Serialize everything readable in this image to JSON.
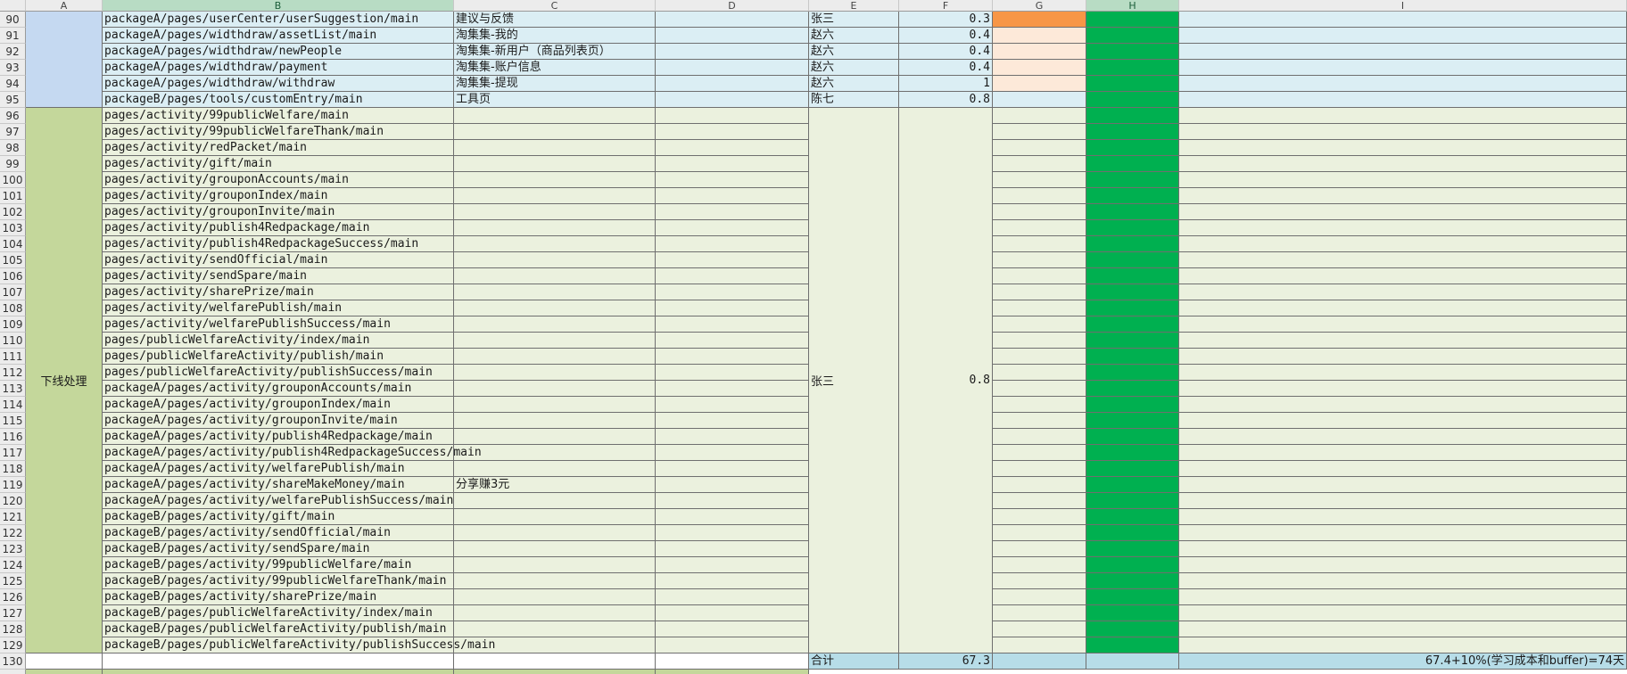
{
  "columns": [
    "A",
    "B",
    "C",
    "D",
    "E",
    "F",
    "G",
    "H",
    "I"
  ],
  "selected_columns": [
    "B",
    "H"
  ],
  "colors": {
    "light_blue": "#dbeef4",
    "mid_blue": "#c5d9f1",
    "total_blue": "#b7dde8",
    "light_green": "#ebf1de",
    "olive_green": "#c4d79b",
    "bright_green": "#00b050",
    "orange": "#f79646",
    "peach": "#fde9d9"
  },
  "rows": [
    {
      "num": "90",
      "b": "packageA/pages/userCenter/userSuggestion/main",
      "c": "建议与反馈",
      "e": "张三",
      "f": "0.3",
      "g": "orange"
    },
    {
      "num": "91",
      "b": "packageA/pages/widthdraw/assetList/main",
      "c": "淘集集-我的",
      "e": "赵六",
      "f": "0.4",
      "g": "peach"
    },
    {
      "num": "92",
      "b": "packageA/pages/widthdraw/newPeople",
      "c": "淘集集-新用户（商品列表页）",
      "e": "赵六",
      "f": "0.4",
      "g": "peach"
    },
    {
      "num": "93",
      "b": "packageA/pages/widthdraw/payment",
      "c": "淘集集-账户信息",
      "e": "赵六",
      "f": "0.4",
      "g": "peach"
    },
    {
      "num": "94",
      "b": "packageA/pages/widthdraw/withdraw",
      "c": "淘集集-提现",
      "e": "赵六",
      "f": "1",
      "g": "peach"
    },
    {
      "num": "95",
      "b": "packageB/pages/tools/customEntry/main",
      "c": "工具页",
      "e": "陈七",
      "f": "0.8",
      "g": "light_blue"
    },
    {
      "num": "96",
      "b": "pages/activity/99publicWelfare/main",
      "c": ""
    },
    {
      "num": "97",
      "b": "pages/activity/99publicWelfareThank/main",
      "c": ""
    },
    {
      "num": "98",
      "b": "pages/activity/redPacket/main",
      "c": ""
    },
    {
      "num": "99",
      "b": "pages/activity/gift/main",
      "c": ""
    },
    {
      "num": "100",
      "b": "pages/activity/grouponAccounts/main",
      "c": ""
    },
    {
      "num": "101",
      "b": "pages/activity/grouponIndex/main",
      "c": ""
    },
    {
      "num": "102",
      "b": "pages/activity/grouponInvite/main",
      "c": ""
    },
    {
      "num": "103",
      "b": "pages/activity/publish4Redpackage/main",
      "c": ""
    },
    {
      "num": "104",
      "b": "pages/activity/publish4RedpackageSuccess/main",
      "c": ""
    },
    {
      "num": "105",
      "b": "pages/activity/sendOfficial/main",
      "c": ""
    },
    {
      "num": "106",
      "b": "pages/activity/sendSpare/main",
      "c": ""
    },
    {
      "num": "107",
      "b": "pages/activity/sharePrize/main",
      "c": ""
    },
    {
      "num": "108",
      "b": "pages/activity/welfarePublish/main",
      "c": ""
    },
    {
      "num": "109",
      "b": "pages/activity/welfarePublishSuccess/main",
      "c": ""
    },
    {
      "num": "110",
      "b": "pages/publicWelfareActivity/index/main",
      "c": ""
    },
    {
      "num": "111",
      "b": "pages/publicWelfareActivity/publish/main",
      "c": ""
    },
    {
      "num": "112",
      "b": "pages/publicWelfareActivity/publishSuccess/main",
      "c": ""
    },
    {
      "num": "113",
      "b": "packageA/pages/activity/grouponAccounts/main",
      "c": ""
    },
    {
      "num": "114",
      "b": "packageA/pages/activity/grouponIndex/main",
      "c": ""
    },
    {
      "num": "115",
      "b": "packageA/pages/activity/grouponInvite/main",
      "c": ""
    },
    {
      "num": "116",
      "b": "packageA/pages/activity/publish4Redpackage/main",
      "c": ""
    },
    {
      "num": "117",
      "b": "packageA/pages/activity/publish4RedpackageSuccess/main",
      "c": ""
    },
    {
      "num": "118",
      "b": "packageA/pages/activity/welfarePublish/main",
      "c": ""
    },
    {
      "num": "119",
      "b": "packageA/pages/activity/shareMakeMoney/main",
      "c": "分享赚3元"
    },
    {
      "num": "120",
      "b": "packageA/pages/activity/welfarePublishSuccess/main",
      "c": ""
    },
    {
      "num": "121",
      "b": "packageB/pages/activity/gift/main",
      "c": ""
    },
    {
      "num": "122",
      "b": "packageB/pages/activity/sendOfficial/main",
      "c": ""
    },
    {
      "num": "123",
      "b": "packageB/pages/activity/sendSpare/main",
      "c": ""
    },
    {
      "num": "124",
      "b": "packageB/pages/activity/99publicWelfare/main",
      "c": ""
    },
    {
      "num": "125",
      "b": "packageB/pages/activity/99publicWelfareThank/main",
      "c": ""
    },
    {
      "num": "126",
      "b": "packageB/pages/activity/sharePrize/main",
      "c": ""
    },
    {
      "num": "127",
      "b": "packageB/pages/publicWelfareActivity/index/main",
      "c": ""
    },
    {
      "num": "128",
      "b": "packageB/pages/publicWelfareActivity/publish/main",
      "c": ""
    },
    {
      "num": "129",
      "b": "packageB/pages/publicWelfareActivity/publishSuccess/main",
      "c": ""
    }
  ],
  "offline_group": {
    "label": "下线处理",
    "assignee": "张三",
    "estimate": "0.8"
  },
  "total_row": {
    "num": "130",
    "label": "合计",
    "value": "67.3",
    "note": "67.4+10%(学习成本和buffer)=74天"
  }
}
